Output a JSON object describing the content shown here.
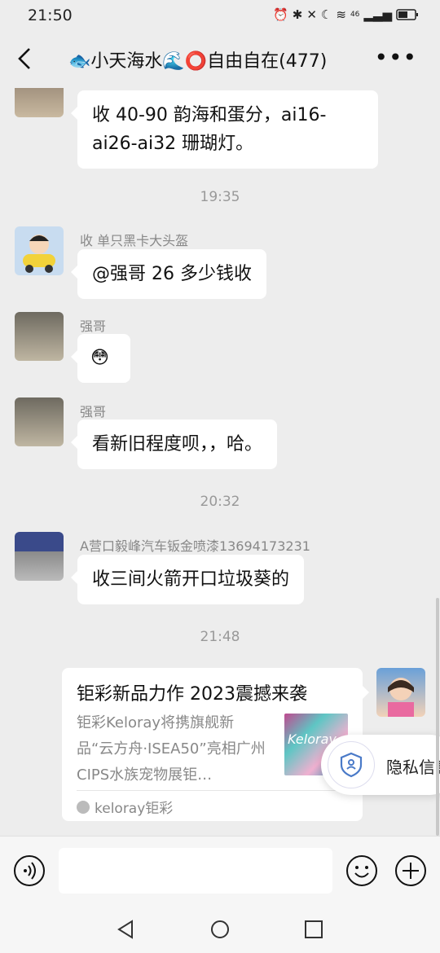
{
  "status_bar": {
    "time": "21:50",
    "network": "46"
  },
  "header": {
    "title": "🐟小天海水🌊⭕自由自在(477)"
  },
  "messages": {
    "m1": {
      "text": "收 40-90 韵海和蛋分，ai16-ai26-ai32 珊瑚灯。"
    },
    "t1": "19:35",
    "m2": {
      "sender": "收 单只黑卡大头盔",
      "text": "@强哥  26 多少钱收"
    },
    "m3": {
      "sender": "强哥",
      "text": "😳"
    },
    "m4": {
      "sender": "强哥",
      "text": "看新旧程度呗，，哈。"
    },
    "t2": "20:32",
    "m5": {
      "sender": "A营口毅峰汽车钣金喷漆13694173231",
      "text": "收三间火箭开口垃圾葵的"
    },
    "t3": "21:48",
    "card": {
      "title": "钜彩新品力作 2023震撼来袭",
      "description": "钜彩Keloray将携旗舰新品“云方舟·ISEA50”亮相广州CIPS水族宠物展钜…",
      "source": "keloray钜彩",
      "thumb_text": "Keloray"
    }
  },
  "privacy_popup": {
    "label": "隐私信息"
  },
  "input_bar": {
    "placeholder": ""
  },
  "colors": {
    "background": "#ededed",
    "bubble": "#ffffff"
  }
}
